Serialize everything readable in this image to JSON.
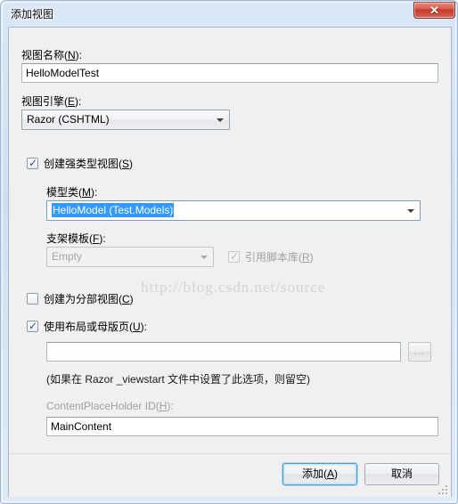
{
  "window": {
    "title": "添加视图",
    "close_glyph": "✕"
  },
  "form": {
    "view_name_label": "视图名称(N):",
    "view_name_value": "HelloModelTest",
    "view_engine_label": "视图引擎(E):",
    "view_engine_value": "Razor (CSHTML)",
    "strongly_typed_label": "创建强类型视图(S)",
    "strongly_typed_checked": true,
    "model_class_label": "模型类(M):",
    "model_class_value": "HelloModel (Test.Models)",
    "scaffold_label": "支架模板(F):",
    "scaffold_value": "Empty",
    "reference_scripts_label": "引用脚本库(R)",
    "reference_scripts_checked": true,
    "partial_view_label": "创建为分部视图(C)",
    "partial_view_checked": false,
    "use_layout_label": "使用布局或母版页(U):",
    "use_layout_checked": true,
    "layout_path_value": "",
    "browse_button_label": "...",
    "layout_hint": "(如果在 Razor _viewstart 文件中设置了此选项，则留空)",
    "content_placeholder_label": "ContentPlaceHolder ID(H):",
    "content_placeholder_value": "MainContent"
  },
  "buttons": {
    "add_label": "添加(A)",
    "cancel_label": "取消"
  },
  "watermark": {
    "text": "http://blog.csdn.net/source"
  },
  "colors": {
    "accent_selection": "#3399ff",
    "dialog_face": "#f0f0f0",
    "close_button": "#c3392b",
    "default_button_border": "#4b9cd4"
  }
}
